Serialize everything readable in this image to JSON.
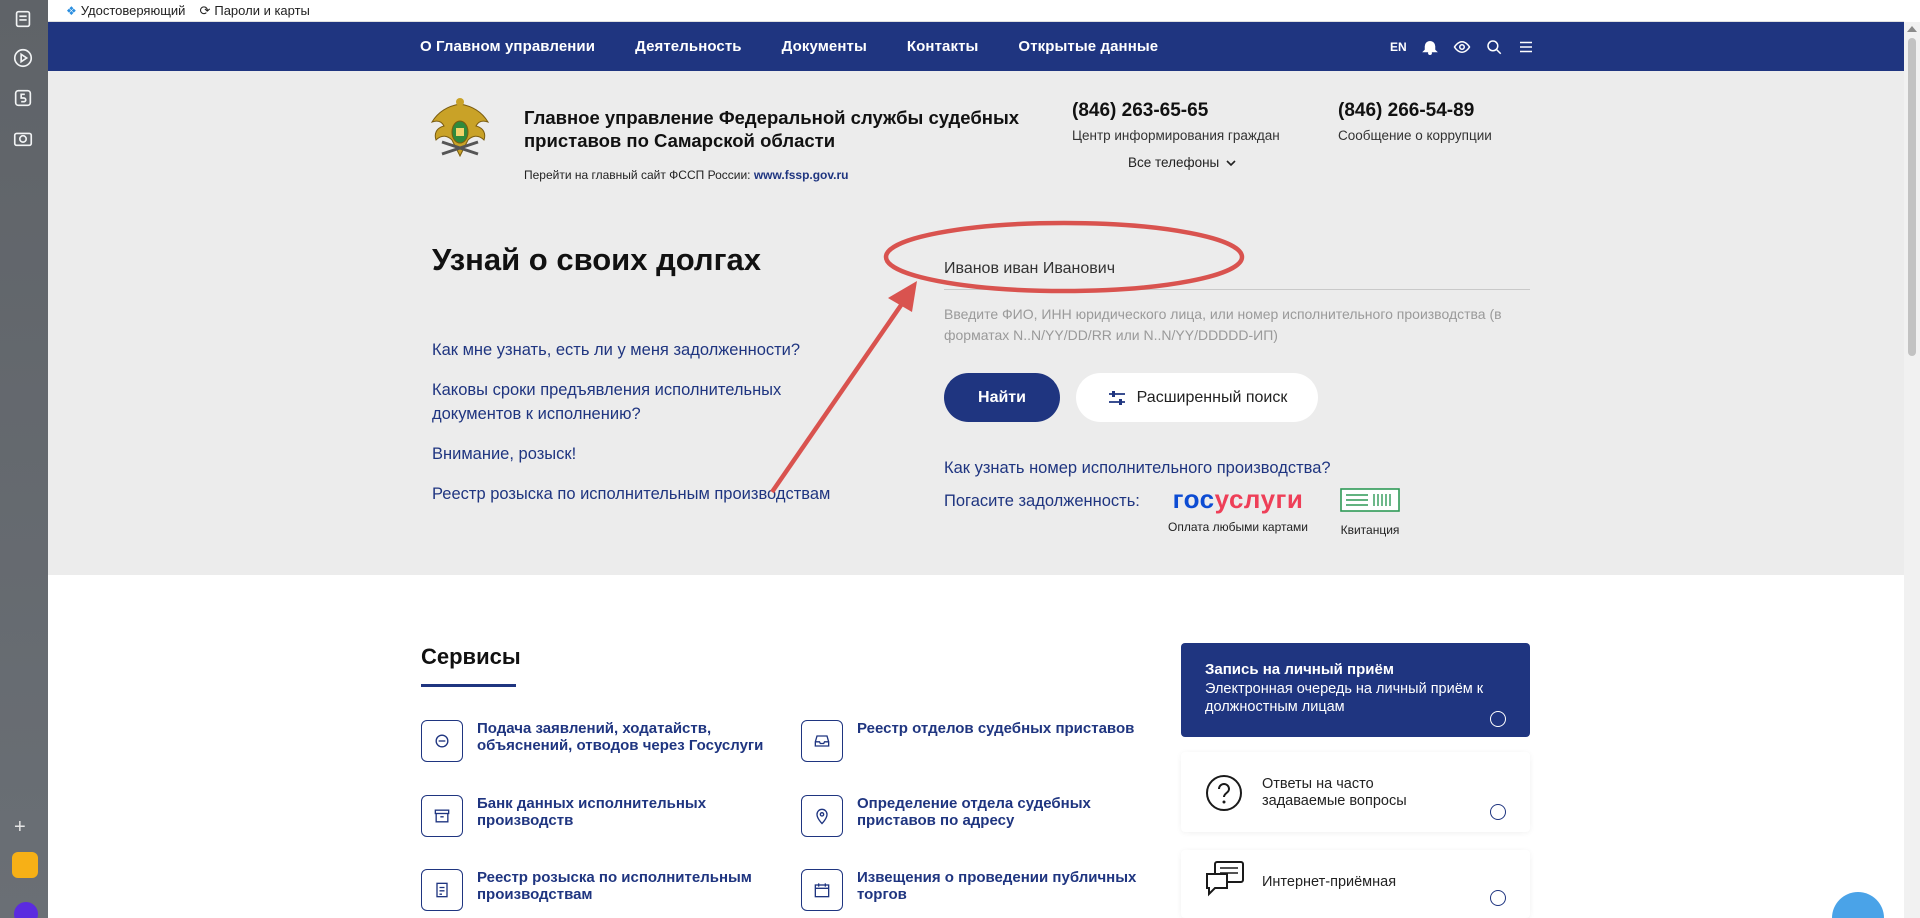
{
  "bookmarks": [
    {
      "label": "Удостоверяющий",
      "icon": "cert-icon"
    },
    {
      "label": "Пароли и карты",
      "icon": "key-icon"
    }
  ],
  "nav": {
    "items": [
      "О Главном управлении",
      "Деятельность",
      "Документы",
      "Контакты",
      "Открытые данные"
    ],
    "lang": "EN"
  },
  "header": {
    "title": "Главное управление Федеральной службы судебных приставов по Самарской области",
    "link_prefix": "Перейти на главный сайт ФССП России:",
    "link_text": "www.fssp.gov.ru",
    "phones": [
      {
        "number": "(846) 263-65-65",
        "caption": "Центр информирования граждан"
      },
      {
        "number": "(846) 266-54-89",
        "caption": "Сообщение о коррупции"
      }
    ],
    "all_phones": "Все телефоны"
  },
  "search": {
    "title": "Узнай о своих долгах",
    "value": "Иванов иван Иванович",
    "hint": "Введите ФИО, ИНН юридического лица, или номер исполнительного производства (в форматах N..N/YY/DD/RR или N..N/YY/DDDDD-ИП)",
    "find_label": "Найти",
    "advanced_label": "Расширенный поиск"
  },
  "faq": [
    "Как мне узнать, есть ли у меня задолженности?",
    "Каковы сроки предъявления исполнительных документов к исполнению?",
    "Внимание, розыск!",
    "Реестр розыска по исполнительным производствам"
  ],
  "payment": {
    "how_know": "Как узнать номер исполнительного производства?",
    "pay_label": "Погасите задолженность:",
    "gos_logo_a": "гос",
    "gos_logo_b": "услуги",
    "gos_caption": "Оплата любыми картами",
    "kvit_caption": "Квитанция"
  },
  "services": {
    "title": "Сервисы",
    "items": [
      "Подача заявлений, ходатайств, объяснений, отводов через Госуслуги",
      "Реестр отделов судебных приставов",
      "Банк данных исполнительных производств",
      "Определение отдела судебных приставов по адресу",
      "Реестр розыска по исполнительным производствам",
      "Извещения о проведении публичных торгов"
    ]
  },
  "cards": {
    "appointment_title": "Запись на личный приём",
    "appointment_desc": "Электронная очередь на личный приём к должностным лицам",
    "faq_title": "Ответы на часто задаваемые вопросы",
    "reception_title": "Интернет-приёмная"
  },
  "colors": {
    "brand": "#1f3580",
    "annotation": "#d9534f",
    "gos_blue": "#0d4cd3",
    "gos_red": "#ee3f58"
  }
}
